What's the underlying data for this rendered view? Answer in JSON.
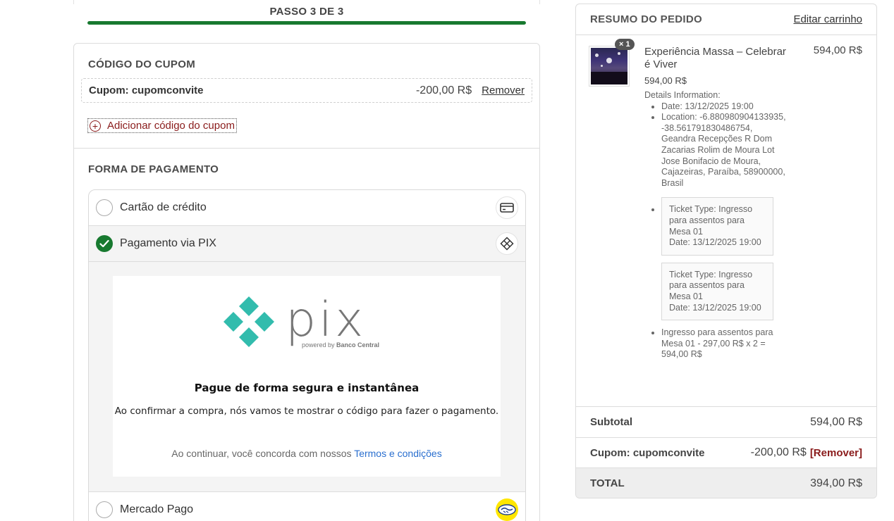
{
  "step": {
    "label": "PASSO 3 DE 3",
    "progress": 1.0
  },
  "coupon": {
    "title": "CÓDIGO DO CUPOM",
    "applied_label": "Cupom: cupomconvite",
    "amount": "-200,00 R$",
    "remove_label": "Remover",
    "add_label": "Adicionar código do cupom"
  },
  "payment": {
    "title": "FORMA DE PAGAMENTO",
    "options": [
      {
        "label": "Cartão de crédito",
        "selected": false,
        "icon": "credit-card-icon"
      },
      {
        "label": "Pagamento via PIX",
        "selected": true,
        "icon": "pix-icon"
      },
      {
        "label": "Mercado Pago",
        "selected": false,
        "icon": "mercado-pago-icon"
      }
    ],
    "pix": {
      "logo_word": "pix",
      "logo_caption": "powered by Banco Central",
      "heading": "Pague de forma segura e instantânea",
      "description": "Ao confirmar a compra, nós vamos te mostrar o código para fazer o pagamento.",
      "terms_prefix": "Ao continuar, você concorda com nossos",
      "terms_link": "Termos e condições"
    }
  },
  "summary": {
    "title": "RESUMO DO PEDIDO",
    "edit_label": "Editar carrinho",
    "item": {
      "quantity_badge": "× 1",
      "name": "Experiência Massa – Celebrar é Viver",
      "price": "594,00 R$",
      "unit_price": "594,00 R$",
      "details_title": "Details Information:",
      "date": "Date: 13/12/2025 19:00",
      "location": "Location: -6.880980904133935, -38.561791830486754, Geandra Recepções R Dom Zacarias Rolim de Moura Lot Jose Bonifacio de Moura, Cajazeiras, Paraíba, 58900000, Brasil",
      "tickets": [
        {
          "type": "Ticket Type: Ingresso para assentos para Mesa 01",
          "date": "Date: 13/12/2025 19:00"
        },
        {
          "type": "Ticket Type: Ingresso para assentos para Mesa 01",
          "date": "Date: 13/12/2025 19:00"
        }
      ],
      "line_total": "Ingresso para assentos para Mesa 01 - 297,00 R$ x 2 = 594,00 R$"
    },
    "subtotal_label": "Subtotal",
    "subtotal_value": "594,00 R$",
    "coupon_label": "Cupom: cupomconvite",
    "coupon_value": "-200,00 R$",
    "coupon_remove": "[Remover]",
    "total_label": "TOTAL",
    "total_value": "394,00 R$"
  },
  "colors": {
    "accent_green": "#17792f",
    "remove_red": "#8a1b1b",
    "link_blue": "#2a6fcf",
    "pix_teal": "#32bcad"
  }
}
